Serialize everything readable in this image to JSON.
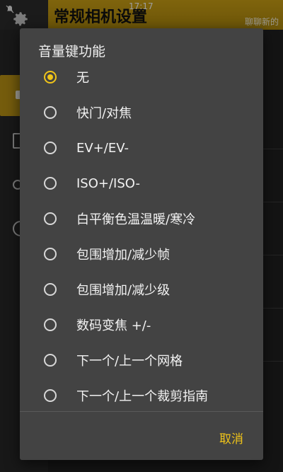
{
  "status_bar": {
    "time": "17:17",
    "notification_icon": "notification-off-icon"
  },
  "background": {
    "title": "常规相机设置",
    "right_text": "聊聊新的",
    "gear_icon": "gear-icon"
  },
  "dialog": {
    "title": "音量键功能",
    "options": [
      {
        "label": "无",
        "checked": true
      },
      {
        "label": "快门/对焦",
        "checked": false
      },
      {
        "label": "EV+/EV-",
        "checked": false
      },
      {
        "label": "ISO+/ISO-",
        "checked": false
      },
      {
        "label": "白平衡色温温暖/寒冷",
        "checked": false
      },
      {
        "label": "包围增加/减少帧",
        "checked": false
      },
      {
        "label": "包围增加/减少级",
        "checked": false
      },
      {
        "label": "数码变焦 +/-",
        "checked": false
      },
      {
        "label": "下一个/上一个网格",
        "checked": false
      },
      {
        "label": "下一个/上一个裁剪指南",
        "checked": false
      }
    ],
    "cancel_label": "取消"
  },
  "colors": {
    "accent": "#f0c419",
    "dialog_bg": "#434343",
    "header_gold": "#c49a14"
  }
}
